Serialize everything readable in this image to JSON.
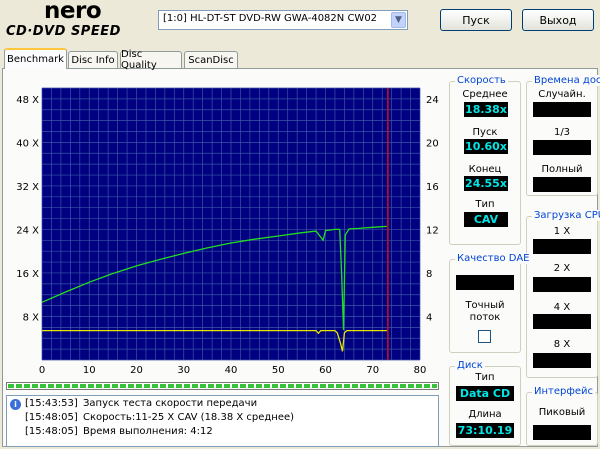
{
  "app": {
    "logo_line1": "nero",
    "logo_line2": "CD·DVD SPEED",
    "drive": "[1:0]  HL-DT-ST DVD-RW GWA-4082N CW02",
    "start_label": "Пуск",
    "exit_label": "Выход"
  },
  "tabs": [
    {
      "label": "Benchmark",
      "active": true
    },
    {
      "label": "Disc Info",
      "active": false
    },
    {
      "label": "Disc Quality",
      "active": false
    },
    {
      "label": "ScanDisc",
      "active": false
    }
  ],
  "speed": {
    "title": "Скорость",
    "avg_label": "Среднее",
    "avg_value": "18.38x",
    "start_label": "Пуск",
    "start_value": "10.60x",
    "end_label": "Конец",
    "end_value": "24.55x",
    "type_label": "Тип",
    "type_value": "CAV"
  },
  "access": {
    "title": "Времена дост",
    "random_label": "Случайн.",
    "third_label": "1/3",
    "full_label": "Полный"
  },
  "cpu": {
    "title": "Загрузка CPU",
    "l1": "1 X",
    "l2": "2 X",
    "l4": "4 X",
    "l8": "8 X"
  },
  "dae": {
    "title": "Качество DAE",
    "accurate_label": "Точный поток"
  },
  "disc": {
    "title": "Диск",
    "type_label": "Тип",
    "type_value": "Data CD",
    "length_label": "Длина",
    "length_value": "73:10.19"
  },
  "iface": {
    "title": "Интерфейс",
    "peak_label": "Пиковый"
  },
  "log": [
    {
      "time": "[15:43:53]",
      "text": "Запуск теста скорости передачи"
    },
    {
      "time": "[15:48:05]",
      "text": "Скорость:11-25 X CAV (18.38 X среднее)"
    },
    {
      "time": "[15:48:05]",
      "text": "Время выполнения:  4:12"
    }
  ],
  "progress": 1.0,
  "chart_data": {
    "type": "line",
    "x_ticks": [
      0,
      10,
      20,
      30,
      40,
      50,
      60,
      70,
      80
    ],
    "y_left_ticks": [
      "8 X",
      "16 X",
      "24 X",
      "32 X",
      "40 X",
      "48 X"
    ],
    "y_right_ticks": [
      4,
      8,
      12,
      16,
      20,
      24
    ],
    "xlim": [
      0,
      80
    ],
    "ylim_left": [
      0,
      50
    ],
    "ylim_right": [
      0,
      25
    ],
    "end_marker_x": 73.2,
    "grid": true,
    "colors": {
      "bg": "#000080",
      "grid": "#3a55a8",
      "speed": "#22dd22",
      "rpm": "#e6e600",
      "marker": "#d01010"
    },
    "series": [
      {
        "color": "speed",
        "x": [
          0,
          5,
          10,
          15,
          20,
          25,
          30,
          35,
          40,
          45,
          50,
          55,
          58,
          59.5,
          60,
          61,
          62,
          63,
          63.4,
          63.8,
          64.2,
          65,
          67,
          70,
          73
        ],
        "y": [
          10.6,
          12.5,
          14.3,
          15.9,
          17.3,
          18.5,
          19.6,
          20.6,
          21.5,
          22.2,
          22.8,
          23.4,
          23.7,
          22.0,
          23.8,
          23.9,
          24.0,
          24.0,
          16.0,
          5.5,
          23.0,
          24.1,
          24.2,
          24.4,
          24.55
        ]
      },
      {
        "color": "rpm",
        "x": [
          0,
          10,
          20,
          30,
          40,
          50,
          58,
          58.5,
          59,
          60,
          62,
          62.5,
          63.2,
          63.6,
          64,
          64.5,
          70,
          73
        ],
        "y": [
          5.4,
          5.4,
          5.4,
          5.4,
          5.4,
          5.4,
          5.4,
          4.9,
          5.4,
          5.4,
          5.4,
          5.0,
          3.0,
          1.6,
          5.0,
          5.4,
          5.4,
          5.4
        ]
      }
    ]
  }
}
